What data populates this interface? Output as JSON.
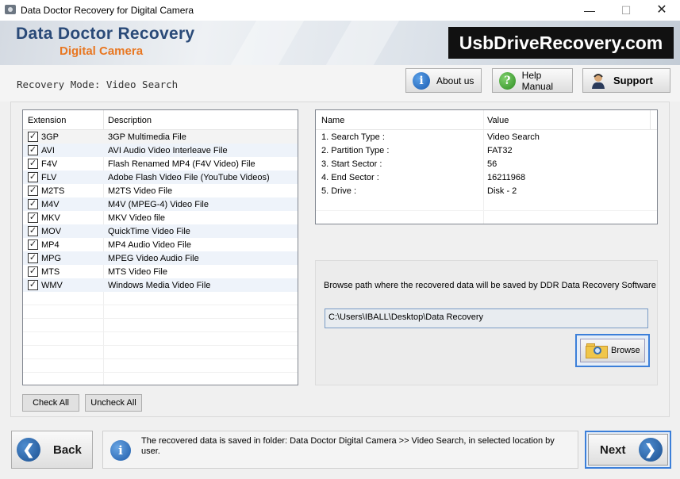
{
  "window": {
    "title": "Data Doctor Recovery for Digital Camera",
    "minimize": "—",
    "maximize": "☐",
    "close": "✕"
  },
  "banner": {
    "brand_line1": "Data Doctor Recovery",
    "brand_line2": "Digital Camera",
    "website": "UsbDriveRecovery.com"
  },
  "toolbar": {
    "mode": "Recovery Mode: Video Search",
    "about": "About us",
    "help": "Help Manual",
    "support": "Support"
  },
  "extensions": {
    "headers": [
      "Extension",
      "Description"
    ],
    "rows": [
      {
        "ext": "3GP",
        "desc": "3GP Multimedia File",
        "checked": true
      },
      {
        "ext": "AVI",
        "desc": "AVI Audio Video Interleave File",
        "checked": true
      },
      {
        "ext": "F4V",
        "desc": "Flash Renamed MP4 (F4V Video) File",
        "checked": true
      },
      {
        "ext": "FLV",
        "desc": "Adobe Flash Video File (YouTube Videos)",
        "checked": true
      },
      {
        "ext": "M2TS",
        "desc": "M2TS Video File",
        "checked": true
      },
      {
        "ext": "M4V",
        "desc": "M4V (MPEG-4) Video File",
        "checked": true
      },
      {
        "ext": "MKV",
        "desc": "MKV Video file",
        "checked": true
      },
      {
        "ext": "MOV",
        "desc": "QuickTime Video File",
        "checked": true
      },
      {
        "ext": "MP4",
        "desc": "MP4 Audio Video File",
        "checked": true
      },
      {
        "ext": "MPG",
        "desc": "MPEG Video Audio File",
        "checked": true
      },
      {
        "ext": "MTS",
        "desc": "MTS Video File",
        "checked": true
      },
      {
        "ext": "WMV",
        "desc": "Windows Media Video File",
        "checked": true
      }
    ],
    "check_all": "Check All",
    "uncheck_all": "Uncheck All"
  },
  "info": {
    "headers": [
      "Name",
      "Value"
    ],
    "rows": [
      {
        "name": "1. Search Type :",
        "value": "Video Search"
      },
      {
        "name": "2. Partition Type :",
        "value": "FAT32"
      },
      {
        "name": "3. Start Sector :",
        "value": "56"
      },
      {
        "name": "4. End Sector :",
        "value": "16211968"
      },
      {
        "name": "5. Drive :",
        "value": "Disk - 2"
      }
    ]
  },
  "browse": {
    "label": "Browse path where the recovered data will be saved by DDR Data Recovery Software",
    "path": "C:\\Users\\IBALL\\Desktop\\Data Recovery",
    "button": "Browse"
  },
  "footer": {
    "back": "Back",
    "next": "Next",
    "message": "The recovered data is saved in folder: Data Doctor Digital Camera  >> Video Search, in selected location by user."
  }
}
